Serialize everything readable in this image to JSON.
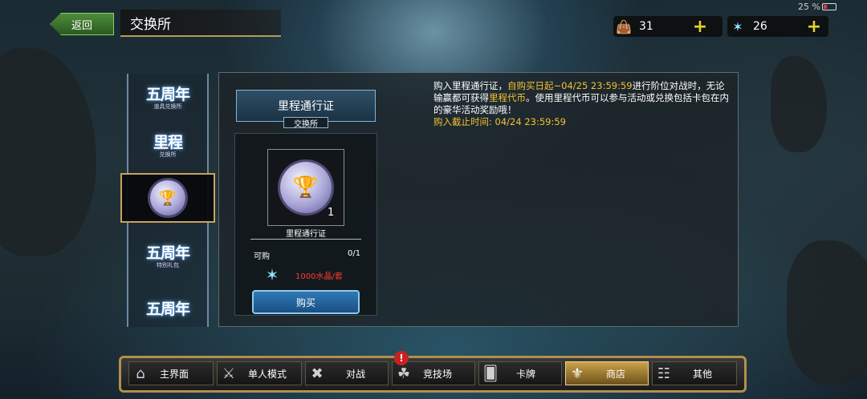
{
  "status": {
    "battery": "25 %"
  },
  "header": {
    "back_label": "返回",
    "title": "交换所"
  },
  "currencies": [
    {
      "icon": "coin-icon",
      "value": "31",
      "plus": "+"
    },
    {
      "icon": "crystal-icon",
      "value": "26",
      "plus": "+"
    }
  ],
  "tabs": [
    {
      "main": "五周年",
      "sub": "道具兑换所"
    },
    {
      "main": "里程",
      "sub": "兑换所"
    },
    {
      "main": "",
      "sub": ""
    },
    {
      "main": "五周年",
      "sub": "特别礼包"
    },
    {
      "main": "五周年",
      "sub": ""
    }
  ],
  "card": {
    "header": "里程通行证",
    "sub": "交换所",
    "item_count": "1",
    "item_name": "里程通行证",
    "limit_label": "可购",
    "limit_value": "0/1",
    "price": "1000水晶/套",
    "buy_label": "购买"
  },
  "description": {
    "p1": "购入里程通行证，",
    "p2": "自购买日起~04/25 23:59:59",
    "p3": "进行阶位对战时，无论输赢都可获得",
    "p4": "里程代币",
    "p5": "。使用里程代币可以参与活动或兑换包括卡包在内的豪华活动奖励哦！",
    "deadline": "购入截止时间: 04/24 23:59:59"
  },
  "nav": {
    "items": [
      {
        "label": "主界面",
        "icon": "home-icon"
      },
      {
        "label": "单人模式",
        "icon": "sword-icon"
      },
      {
        "label": "对战",
        "icon": "crossed-swords-icon"
      },
      {
        "label": "竞技场",
        "icon": "arena-icon"
      },
      {
        "label": "卡牌",
        "icon": "cards-icon"
      },
      {
        "label": "商店",
        "icon": "shop-icon",
        "active": true
      },
      {
        "label": "其他",
        "icon": "other-icon"
      }
    ],
    "badge": "!"
  }
}
